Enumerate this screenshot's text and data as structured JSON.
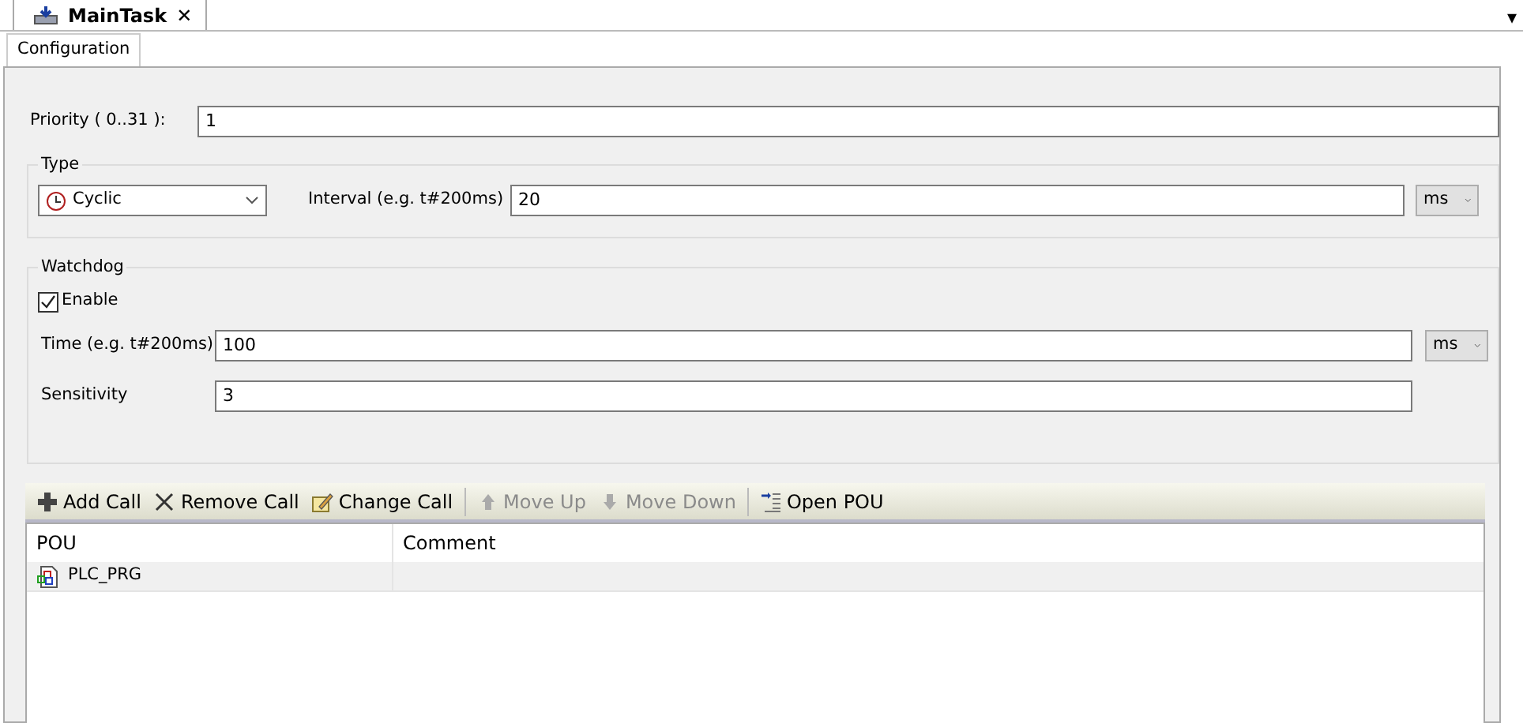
{
  "editor_tab": {
    "title": "MainTask",
    "close": "✕",
    "menu": "▾"
  },
  "sub_tabs": [
    {
      "label": "Configuration",
      "selected": true
    }
  ],
  "priority": {
    "label": "Priority ( 0..31  ):",
    "value": "1"
  },
  "type_group": {
    "title": "Type",
    "type_value": "Cyclic",
    "interval_label": "Interval (e.g. t#200ms)",
    "interval_value": "20",
    "interval_unit": "ms"
  },
  "watchdog": {
    "title": "Watchdog",
    "enable_label": "Enable",
    "checked": true,
    "time_label": "Time (e.g. t#200ms)",
    "time_value": "100",
    "time_unit": "ms",
    "sensitivity_label": "Sensitivity",
    "sensitivity_value": "3"
  },
  "toolbar": [
    {
      "label": "Add Call",
      "kind": "add",
      "disabled": false
    },
    {
      "label": "Remove Call",
      "kind": "remove",
      "disabled": false
    },
    {
      "label": "Change Call",
      "kind": "edit",
      "disabled": false
    },
    {
      "label": "Move Up",
      "kind": "up",
      "disabled": true
    },
    {
      "label": "Move Down",
      "kind": "down",
      "disabled": true
    },
    {
      "label": "Open POU",
      "kind": "open",
      "disabled": false
    }
  ],
  "table": {
    "columns": [
      "POU",
      "Comment"
    ],
    "rows": [
      {
        "pou": "PLC_PRG",
        "comment": ""
      }
    ]
  }
}
